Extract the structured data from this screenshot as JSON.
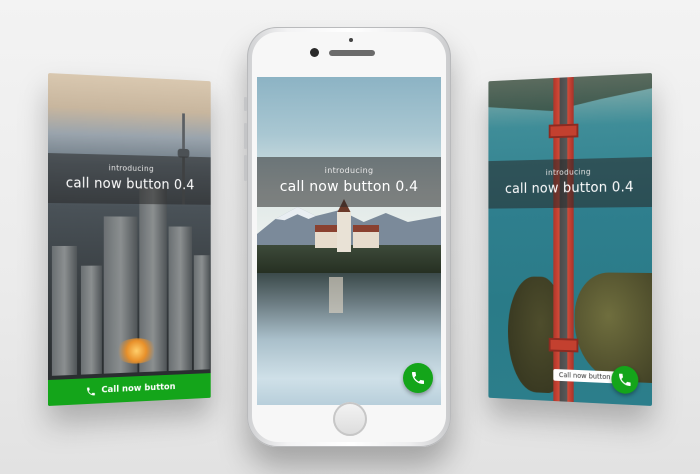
{
  "left_screen": {
    "banner_small": "introducing",
    "banner_big": "call now button 0.4",
    "call_bar_label": "Call now button"
  },
  "center_screen": {
    "banner_small": "introducing",
    "banner_big": "call now button 0.4"
  },
  "right_screen": {
    "banner_small": "introducing",
    "banner_big": "call now button 0.4",
    "pill_label": "Call now button"
  },
  "colors": {
    "call_green": "#14a51a",
    "banner_overlay": "rgba(40,40,40,.55)"
  },
  "icons": {
    "call": "phone-icon"
  }
}
